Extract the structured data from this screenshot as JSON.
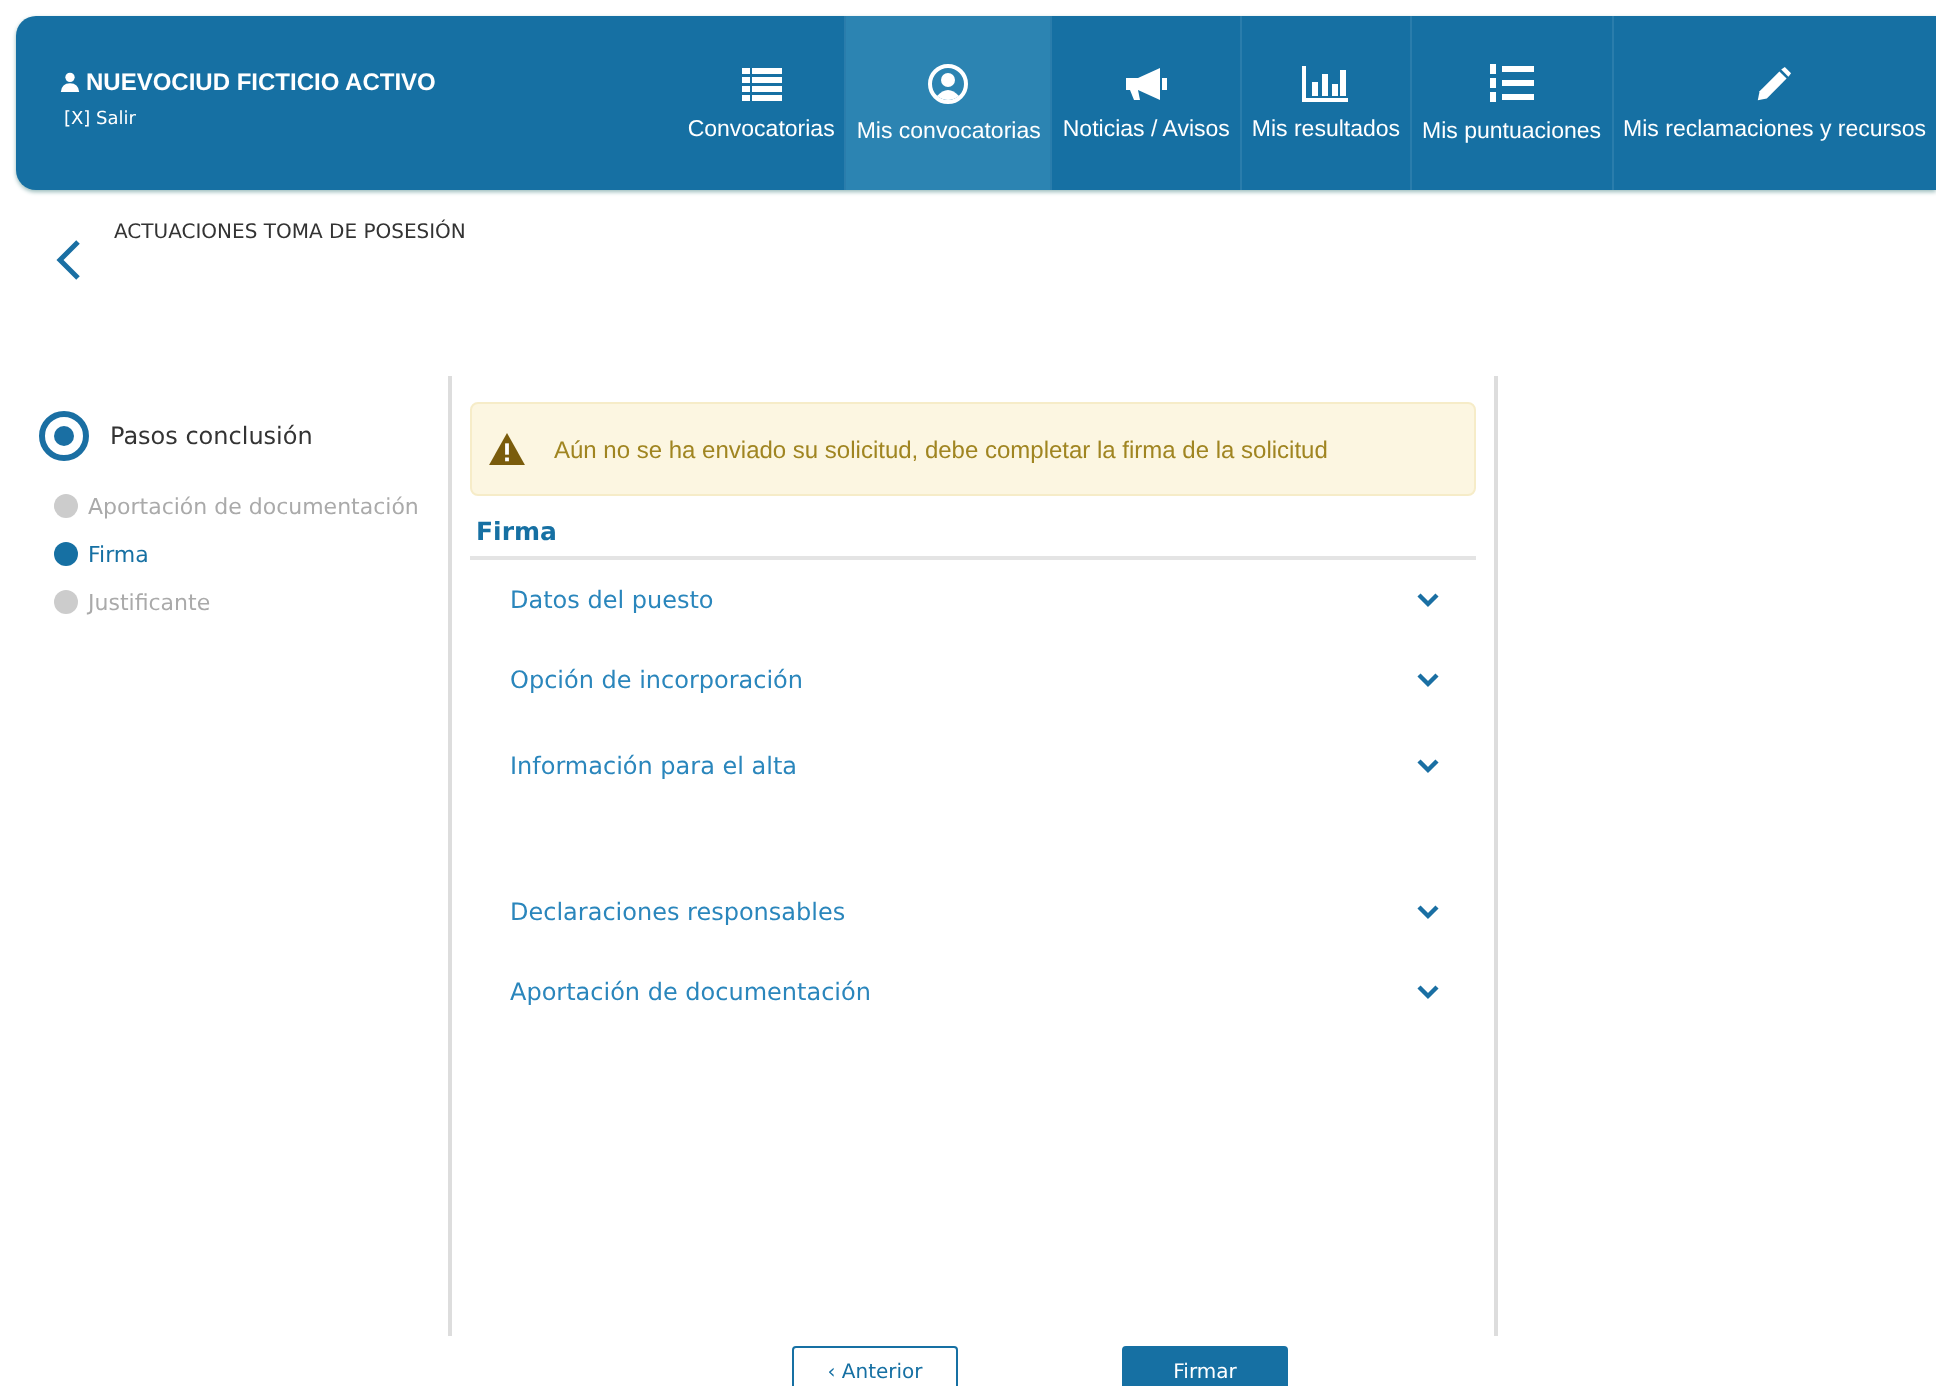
{
  "user": {
    "name": "NUEVOCIUD FICTICIO ACTIVO",
    "logout": "[X] Salir"
  },
  "nav": [
    {
      "label": "Convocatorias",
      "kind": "list",
      "selected": false
    },
    {
      "label": "Mis convocatorias",
      "kind": "user",
      "selected": true
    },
    {
      "label": "Noticias / Avisos",
      "kind": "megaphone",
      "selected": false
    },
    {
      "label": "Mis resultados",
      "kind": "chart",
      "selected": false
    },
    {
      "label": "Mis puntuaciones",
      "kind": "numbered",
      "selected": false
    },
    {
      "label": "Mis reclamaciones y recursos",
      "kind": "pencil",
      "selected": false
    }
  ],
  "page_title": "ACTUACIONES TOMA DE POSESIÓN",
  "steps": {
    "title": "Pasos conclusión",
    "items": [
      {
        "label": "Aportación de documentación",
        "selected": false
      },
      {
        "label": "Firma",
        "selected": true
      },
      {
        "label": "Justificante",
        "selected": false
      }
    ]
  },
  "alert": "Aún no se ha enviado su solicitud, debe completar la firma de la solicitud",
  "section_title": "Firma",
  "sections": [
    {
      "title": "Datos del puesto",
      "expanded": false
    },
    {
      "title": "Opción de incorporación",
      "expanded": false
    },
    {
      "title": "Información para el alta",
      "expanded": false
    },
    {
      "title": "Declaraciones responsables",
      "expanded": false
    },
    {
      "title": "Aportación de documentación",
      "expanded": false
    }
  ],
  "buttons": {
    "back": "‹ Anterior",
    "sign": "Firmar"
  }
}
